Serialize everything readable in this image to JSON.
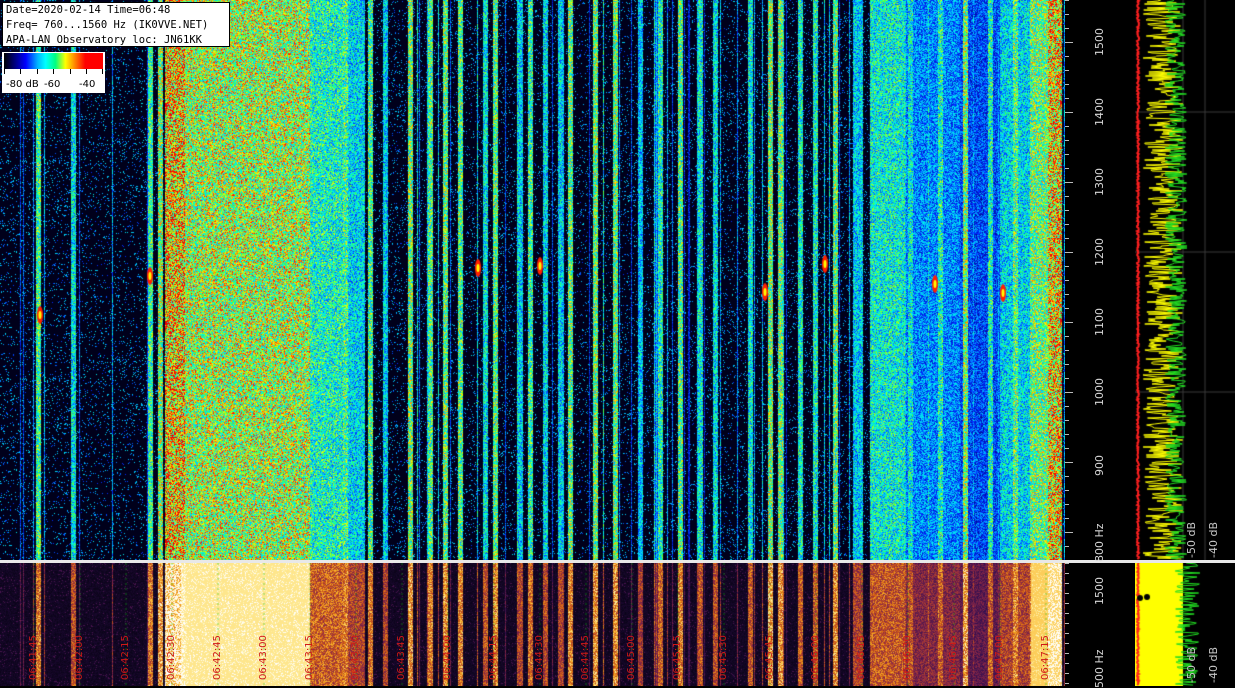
{
  "info": {
    "line1": "Date=2020-02-14 Time=06:48",
    "line2": "Freq= 760...1560 Hz (IK0VVE.NET)",
    "line3": "APA-LAN Observatory loc: JN61KK"
  },
  "legend": {
    "labels": [
      "-80 dB",
      "-60",
      "-40"
    ],
    "colors": [
      "#000000",
      "#0000ff",
      "#00ffff",
      "#00ff80",
      "#ffff00",
      "#ff8000",
      "#ff0000"
    ]
  },
  "freq_axis": {
    "labels": [
      "1500",
      "1400",
      "1300",
      "1200",
      "1100",
      "1000",
      "900",
      "800 Hz"
    ],
    "values": [
      1500,
      1400,
      1300,
      1200,
      1100,
      1000,
      900,
      800
    ],
    "range": [
      760,
      1560
    ]
  },
  "bottom_freq_axis": {
    "labels": [
      "1500",
      "500 Hz"
    ],
    "values": [
      1500,
      500
    ]
  },
  "spectrum_labels": {
    "main": [
      "-50 dB",
      "-40 dB"
    ],
    "bottom": [
      "-50 dB",
      "-40 dB"
    ]
  },
  "time_axis": {
    "labels": [
      "06:41:45",
      "06:42:00",
      "06:42:15",
      "06:42:30",
      "06:42:45",
      "06:43:00",
      "06:43:15",
      "06:43:30",
      "06:43:45",
      "06:44:00",
      "06:44:15",
      "06:44:30",
      "06:44:45",
      "06:45:00",
      "06:45:15",
      "06:45:30",
      "06:45:45",
      "06:46:00",
      "06:46:15",
      "06:46:30",
      "06:46:45",
      "06:47:00",
      "06:47:15"
    ]
  },
  "colors": {
    "time_label": "#d01818",
    "trace_yellow": "#ffff00",
    "trace_green": "#22dd22",
    "trace_red": "#ff2020"
  }
}
